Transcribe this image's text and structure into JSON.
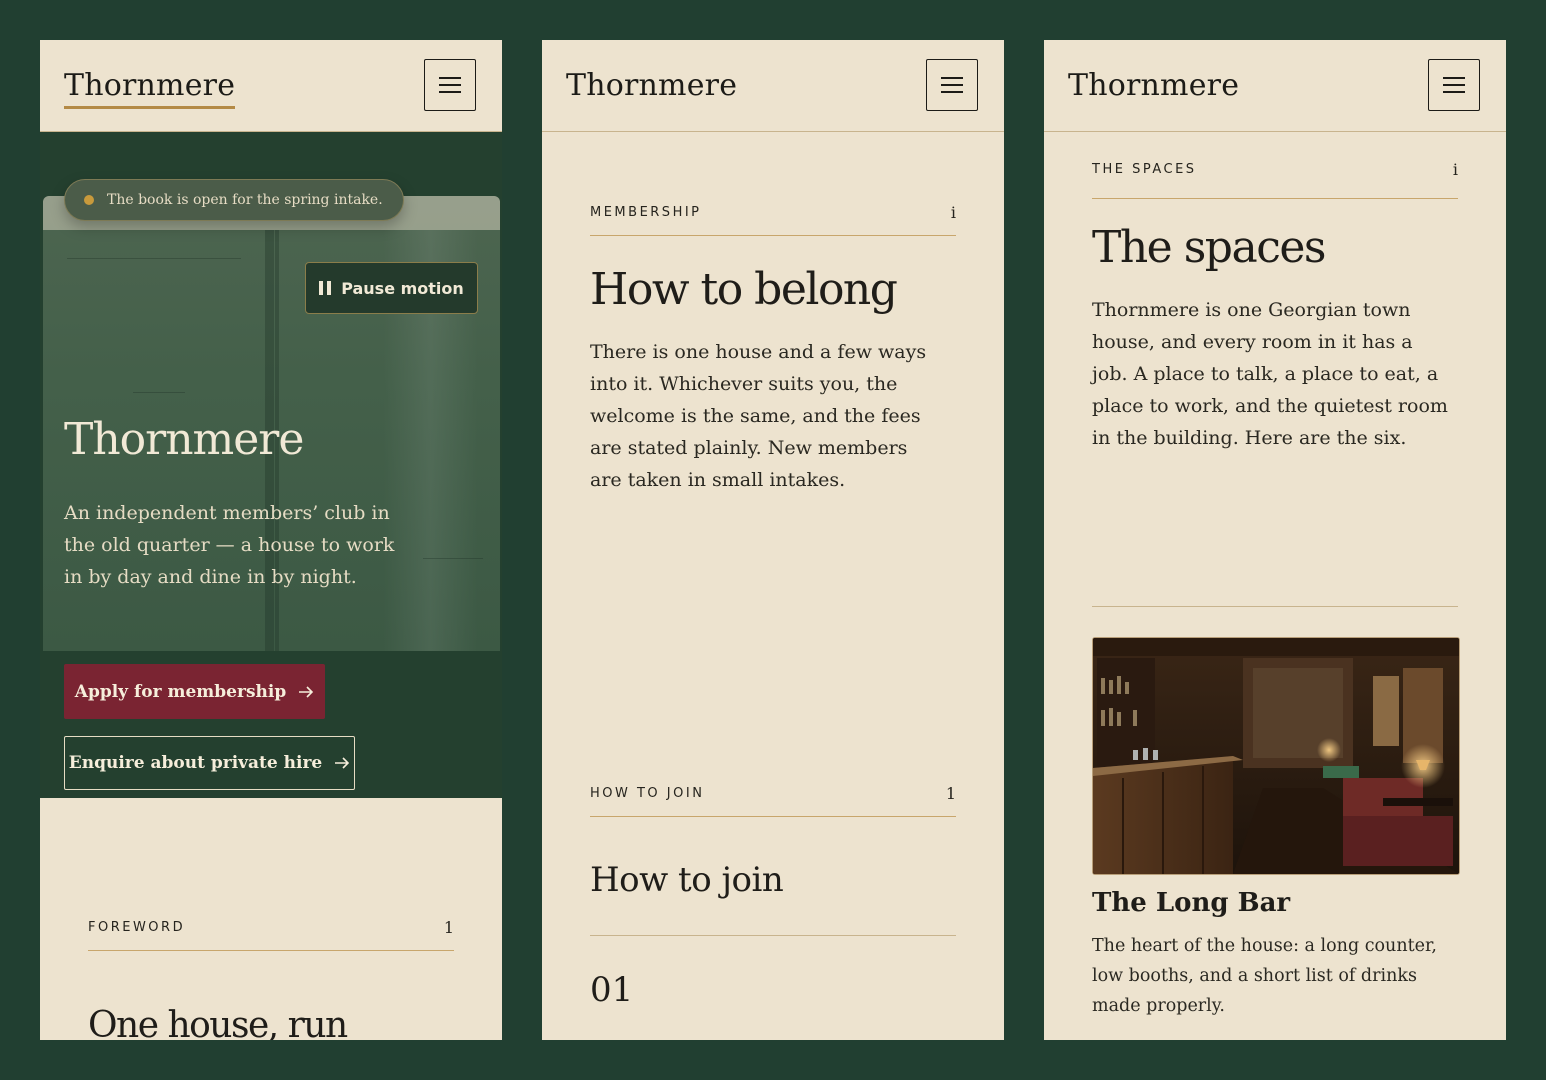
{
  "colors": {
    "page_bg": "#213f31",
    "paper": "#ede3cf",
    "ink": "#1c1b17",
    "gold": "#b48a45",
    "burgundy": "#7a2432",
    "hero_green": "#24402f"
  },
  "brand": "Thornmere",
  "icons": {
    "menu": "hamburger-icon",
    "pause": "pause-icon",
    "arrow": "arrow-right-icon",
    "dot": "status-dot-icon"
  },
  "screens": [
    {
      "hero": {
        "announcement": "The book is open for the spring intake.",
        "pause_label": "Pause motion",
        "title": "Thornmere",
        "description": "An independent members’ club in the old quarter — a house to work in by day and dine in by night.",
        "primary_cta": "Apply for membership",
        "secondary_cta": "Enquire about private hire"
      },
      "section": {
        "eyebrow": "FOREWORD",
        "number": "1",
        "title": "One house, run"
      }
    },
    {
      "section": {
        "eyebrow": "MEMBERSHIP",
        "number": "i",
        "title": "How to belong",
        "body": "There is one house and a few ways into it. Whichever suits you, the welcome is the same, and the fees are stated plainly. New members are taken in small intakes."
      },
      "subsection": {
        "eyebrow": "HOW TO JOIN",
        "number": "1",
        "title": "How to join",
        "step": "01"
      }
    },
    {
      "section": {
        "eyebrow": "THE SPACES",
        "number": "i",
        "title": "The spaces",
        "body": "Thornmere is one Georgian town house, and every room in it has a job. A place to talk, a place to eat, a place to work, and the quietest room in the building. Here are the six."
      },
      "card": {
        "title": "The Long Bar",
        "description": "The heart of the house: a long counter, low booths, and a short list of drinks made properly."
      }
    }
  ]
}
